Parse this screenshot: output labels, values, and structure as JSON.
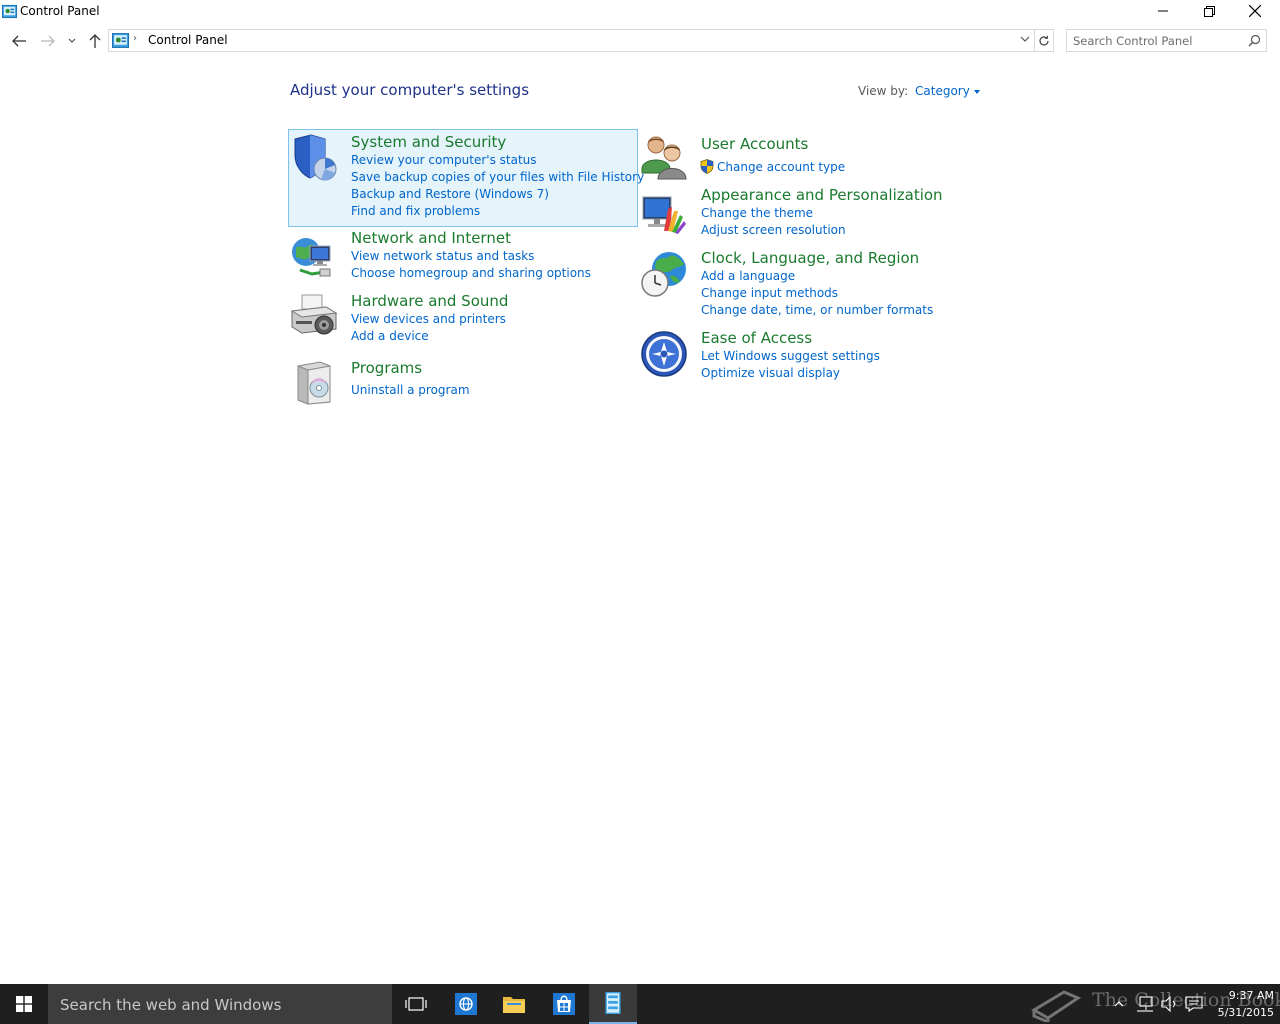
{
  "window": {
    "title": "Control Panel"
  },
  "address": {
    "breadcrumb": "Control Panel",
    "search_placeholder": "Search Control Panel"
  },
  "main": {
    "heading": "Adjust your computer's settings",
    "view_by_label": "View by:",
    "view_by_value": "Category"
  },
  "categories": [
    {
      "title": "System and Security",
      "icon": "shield-icon",
      "links": [
        "Review your computer's status",
        "Save backup copies of your files with File History",
        "Backup and Restore (Windows 7)",
        "Find and fix problems"
      ]
    },
    {
      "title": "Network and Internet",
      "icon": "network-icon",
      "links": [
        "View network status and tasks",
        "Choose homegroup and sharing options"
      ]
    },
    {
      "title": "Hardware and Sound",
      "icon": "printer-icon",
      "links": [
        "View devices and printers",
        "Add a device"
      ]
    },
    {
      "title": "Programs",
      "icon": "programs-icon",
      "links": [
        "Uninstall a program"
      ]
    },
    {
      "title": "User Accounts",
      "icon": "users-icon",
      "links": [
        "Change account type"
      ]
    },
    {
      "title": "Appearance and Personalization",
      "icon": "appearance-icon",
      "links": [
        "Change the theme",
        "Adjust screen resolution"
      ]
    },
    {
      "title": "Clock, Language, and Region",
      "icon": "clock-globe-icon",
      "links": [
        "Add a language",
        "Change input methods",
        "Change date, time, or number formats"
      ]
    },
    {
      "title": "Ease of Access",
      "icon": "ease-of-access-icon",
      "links": [
        "Let Windows suggest settings",
        "Optimize visual display"
      ]
    }
  ],
  "taskbar": {
    "search_text": "Search the web and Windows",
    "time": "9:37 AM",
    "date": "5/31/2015",
    "watermark": "The Collection Book"
  },
  "colors": {
    "category_title": "#1a7a2e",
    "link": "#0066cc",
    "heading": "#1e3287",
    "selected_bg": "#e5f3fb",
    "selected_border": "#7cc1e8",
    "taskbar": "#1f1f1f"
  }
}
